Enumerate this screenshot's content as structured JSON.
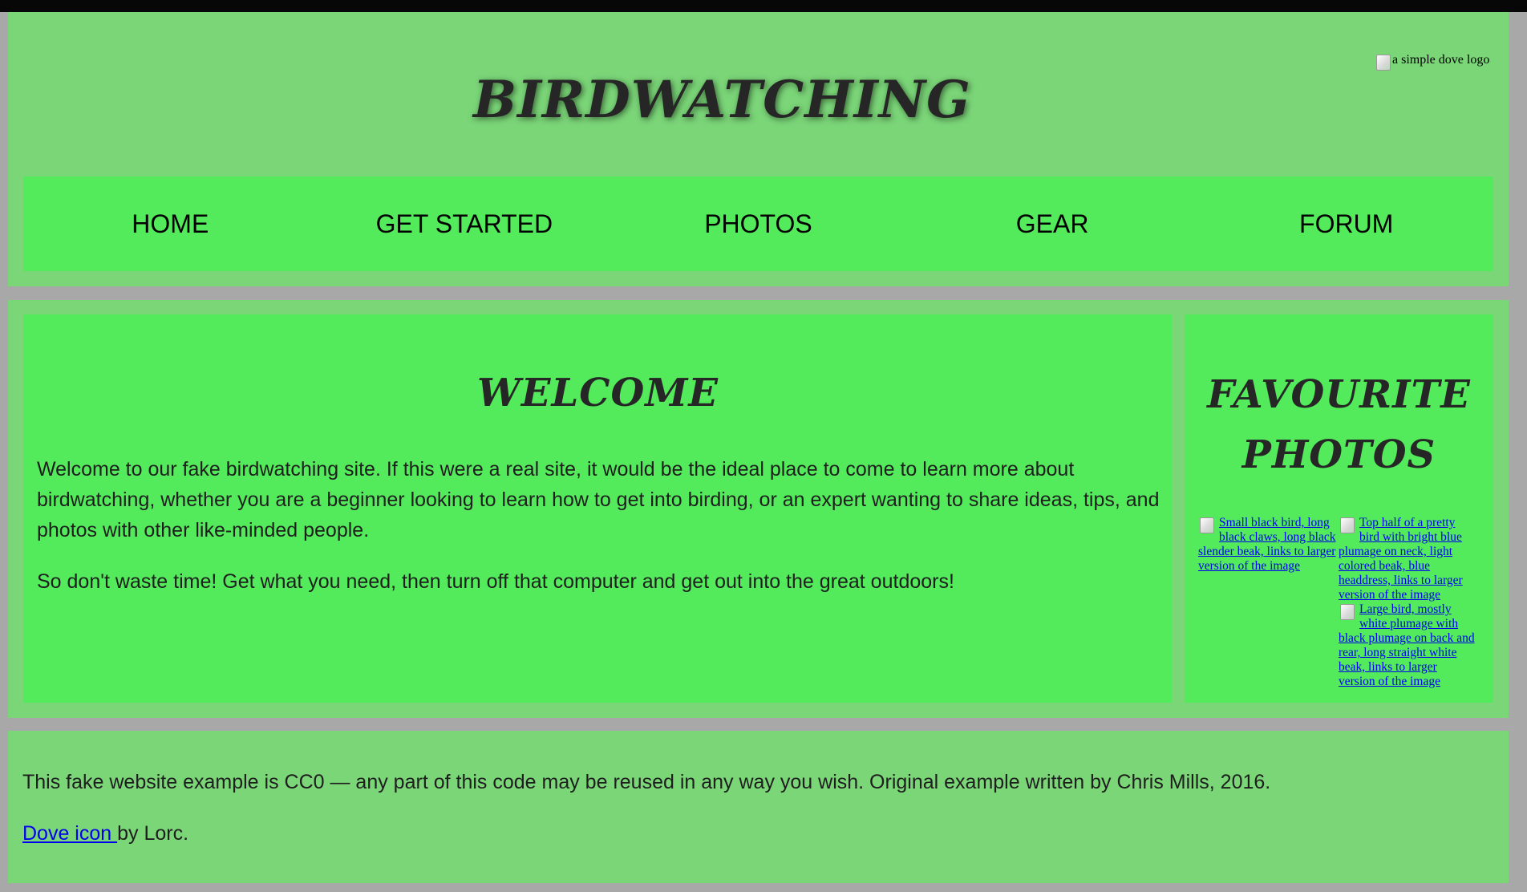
{
  "header": {
    "title": "BIRDWATCHING",
    "logo_alt": "a simple dove logo",
    "nav": [
      {
        "label": "HOME"
      },
      {
        "label": "GET STARTED"
      },
      {
        "label": "PHOTOS"
      },
      {
        "label": "GEAR"
      },
      {
        "label": "FORUM"
      }
    ]
  },
  "main": {
    "heading": "WELCOME",
    "paragraphs": [
      "Welcome to our fake birdwatching site. If this were a real site, it would be the ideal place to come to learn more about birdwatching, whether you are a beginner looking to learn how to get into birding, or an expert wanting to share ideas, tips, and photos with other like-minded people.",
      "So don't waste time! Get what you need, then turn off that computer and get out into the great outdoors!"
    ]
  },
  "sidebar": {
    "heading_line1": "FAVOURITE",
    "heading_line2": "PHOTOS",
    "photos": [
      {
        "alt": "Small black bird, long black claws, long black slender beak, links to larger version of the image"
      },
      {
        "alt": "Top half of a pretty bird with bright blue plumage on neck, light colored beak, blue headdress, links to larger version of the image"
      },
      {
        "alt": "Large bird, mostly white plumage with black plumage on back and rear, long straight white beak, links to larger version of the image"
      }
    ]
  },
  "footer": {
    "license_text": "This fake website example is CC0 — any part of this code may be reused in any way you wish. Original example written by Chris Mills, 2016.",
    "dove_link_text": "Dove icon ",
    "dove_suffix": "by Lorc."
  },
  "colors": {
    "page_background": "#a8a8a8",
    "panel_light": "#7bd678",
    "panel_bright": "#53eb5b",
    "link": "#0000ee"
  }
}
